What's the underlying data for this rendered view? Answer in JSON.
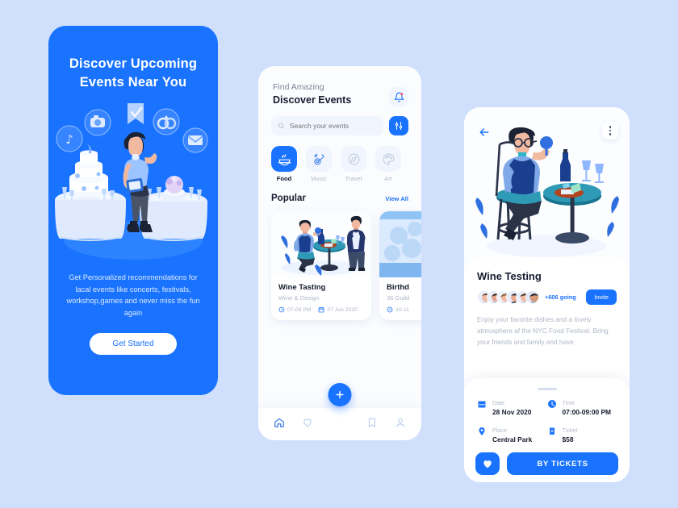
{
  "theme": {
    "accent": "#1a73ff",
    "page_bg": "#cfdffc",
    "dark_text": "#141b2d",
    "muted_text": "#aeb6c5"
  },
  "onboarding": {
    "title_line1": "Discover Upcoming",
    "title_line2": "Events Near You",
    "description": "Get Personalized recommendations for lacal events like concerts, festivals, workshop,games and never miss the fun again",
    "cta_label": "Get Started",
    "illustration": "wedding-planner-with-cakes-and-tables",
    "floating_icons": [
      "music-icon",
      "camera-icon",
      "checkmark-bookmark-icon",
      "rings-icon",
      "envelope-icon",
      "heart-icon"
    ]
  },
  "discover": {
    "greeting": "Find Amazing",
    "title": "Discover Events",
    "bell_icon": "notification-bell-icon",
    "search": {
      "placeholder": "Search your events",
      "value": "",
      "icon": "search-icon"
    },
    "filter_icon": "filter-sliders-icon",
    "categories": [
      {
        "label": "Food",
        "icon": "food-bowl-icon",
        "active": true
      },
      {
        "label": "Music",
        "icon": "guitar-icon",
        "active": false
      },
      {
        "label": "Travel",
        "icon": "compass-icon",
        "active": false
      },
      {
        "label": "Art",
        "icon": "palette-icon",
        "active": false
      }
    ],
    "section_title": "Popular",
    "view_all_label": "View All",
    "cards": [
      {
        "name": "Wine Tasting",
        "subtitle": "Wine & Design",
        "time": "07-09 PM",
        "date": "07 Jun 2020",
        "illustration": "two-men-at-wine-table"
      },
      {
        "name": "Birthd",
        "subtitle": "36 Guild",
        "time": "10-11",
        "date": "",
        "illustration": "person-on-ladder-with-balloons"
      }
    ],
    "fab_label": "+",
    "tabs": [
      {
        "icon": "home-icon",
        "active": true
      },
      {
        "icon": "heart-icon",
        "active": false
      },
      {
        "icon": "bookmark-icon",
        "active": false
      },
      {
        "icon": "profile-icon",
        "active": false
      }
    ]
  },
  "detail": {
    "back_icon": "back-arrow-icon",
    "menu_icon": "more-vertical-icon",
    "hero_illustration": "man-on-stool-with-wine-table",
    "title": "Wine Testing",
    "going_count": "+606 going",
    "invite_label": "Invite",
    "description": "Enjoy your favorite dishes and a lovely atmosphere af the NYC Food Festival. Bring your friends and family and have",
    "info": [
      {
        "label": "Date",
        "value": "28 Nov 2020",
        "icon": "calendar-icon"
      },
      {
        "label": "Time",
        "value": "07:00-09:00 PM",
        "icon": "clock-icon"
      },
      {
        "label": "Place",
        "value": "Central Park",
        "icon": "location-pin-icon"
      },
      {
        "label": "Ticket",
        "value": "$58",
        "icon": "ticket-icon"
      }
    ],
    "favorite_icon": "heart-filled-icon",
    "buy_label": "BY TICKETS"
  }
}
